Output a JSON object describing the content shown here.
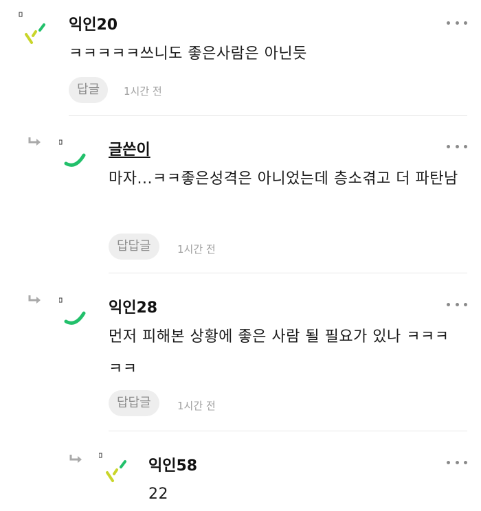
{
  "comments": [
    {
      "author": "익인20",
      "text": "ㅋㅋㅋㅋㅋ쓰니도 좋은사람은 아닌듯",
      "reply_label": "답글",
      "time": "1시간 전"
    },
    {
      "author": "글쓴이",
      "text": "마자...ㅋㅋ좋은성격은 아니었는데 층소겪고 더 파탄남",
      "reply_label": "답답글",
      "time": "1시간 전"
    },
    {
      "author": "익인28",
      "text": "먼저 피해본 상황에 좋은 사람 될 필요가 있나 ㅋㅋㅋㅋㅋ",
      "reply_label": "답답글",
      "time": "1시간 전"
    },
    {
      "author": "익인58",
      "text": "22"
    }
  ],
  "colors": {
    "avatar_green": "#22c06b",
    "avatar_yellow": "#c9d52a",
    "muted_gray": "#a0a0a0"
  },
  "icons": {
    "reply_arrow": "reply-arrow-icon",
    "more": "more-options-icon",
    "avatar_dashes": "avatar-dashes-icon",
    "avatar_smile": "avatar-smile-icon"
  }
}
